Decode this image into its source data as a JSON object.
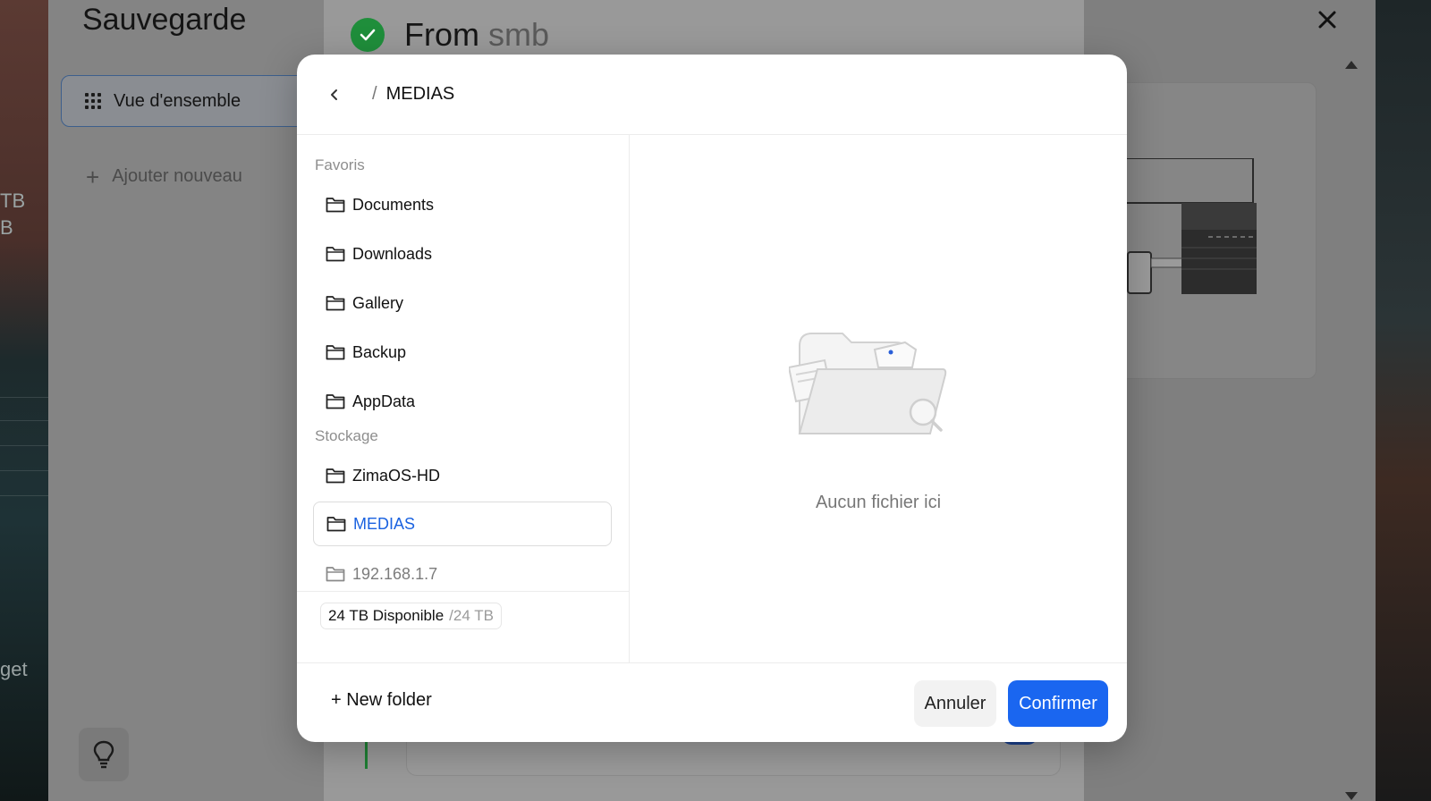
{
  "background": {
    "left_fragments": [
      "TB",
      "B",
      "get"
    ]
  },
  "app": {
    "title": "Sauvegarde",
    "nav_overview": "Vue d'ensemble",
    "nav_add": "Ajouter nouveau",
    "main_title_prefix": "From",
    "main_title_source": "smb"
  },
  "modal": {
    "breadcrumb_separator": "/",
    "current_path": "MEDIAS",
    "favorites_label": "Favoris",
    "favorites": [
      {
        "label": "Documents"
      },
      {
        "label": "Downloads"
      },
      {
        "label": "Gallery"
      },
      {
        "label": "Backup"
      },
      {
        "label": "AppData"
      }
    ],
    "storage_label": "Stockage",
    "storage": [
      {
        "label": "ZimaOS-HD"
      },
      {
        "label": "MEDIAS",
        "selected": true
      },
      {
        "label": "192.168.1.7"
      }
    ],
    "storage_available": "24 TB Disponible",
    "storage_total": "/24 TB",
    "empty_message": "Aucun fichier ici",
    "new_folder_label": "+ New folder",
    "cancel_label": "Annuler",
    "confirm_label": "Confirmer"
  },
  "colors": {
    "accent": "#1a66f0",
    "selected_text": "#1a62e0",
    "status_green": "#1f8e3b"
  },
  "icons": [
    "grid-icon",
    "plus-icon",
    "lightbulb-icon",
    "check-icon",
    "close-icon",
    "chevron-left-icon",
    "folder-icon",
    "empty-folder-illustration"
  ]
}
